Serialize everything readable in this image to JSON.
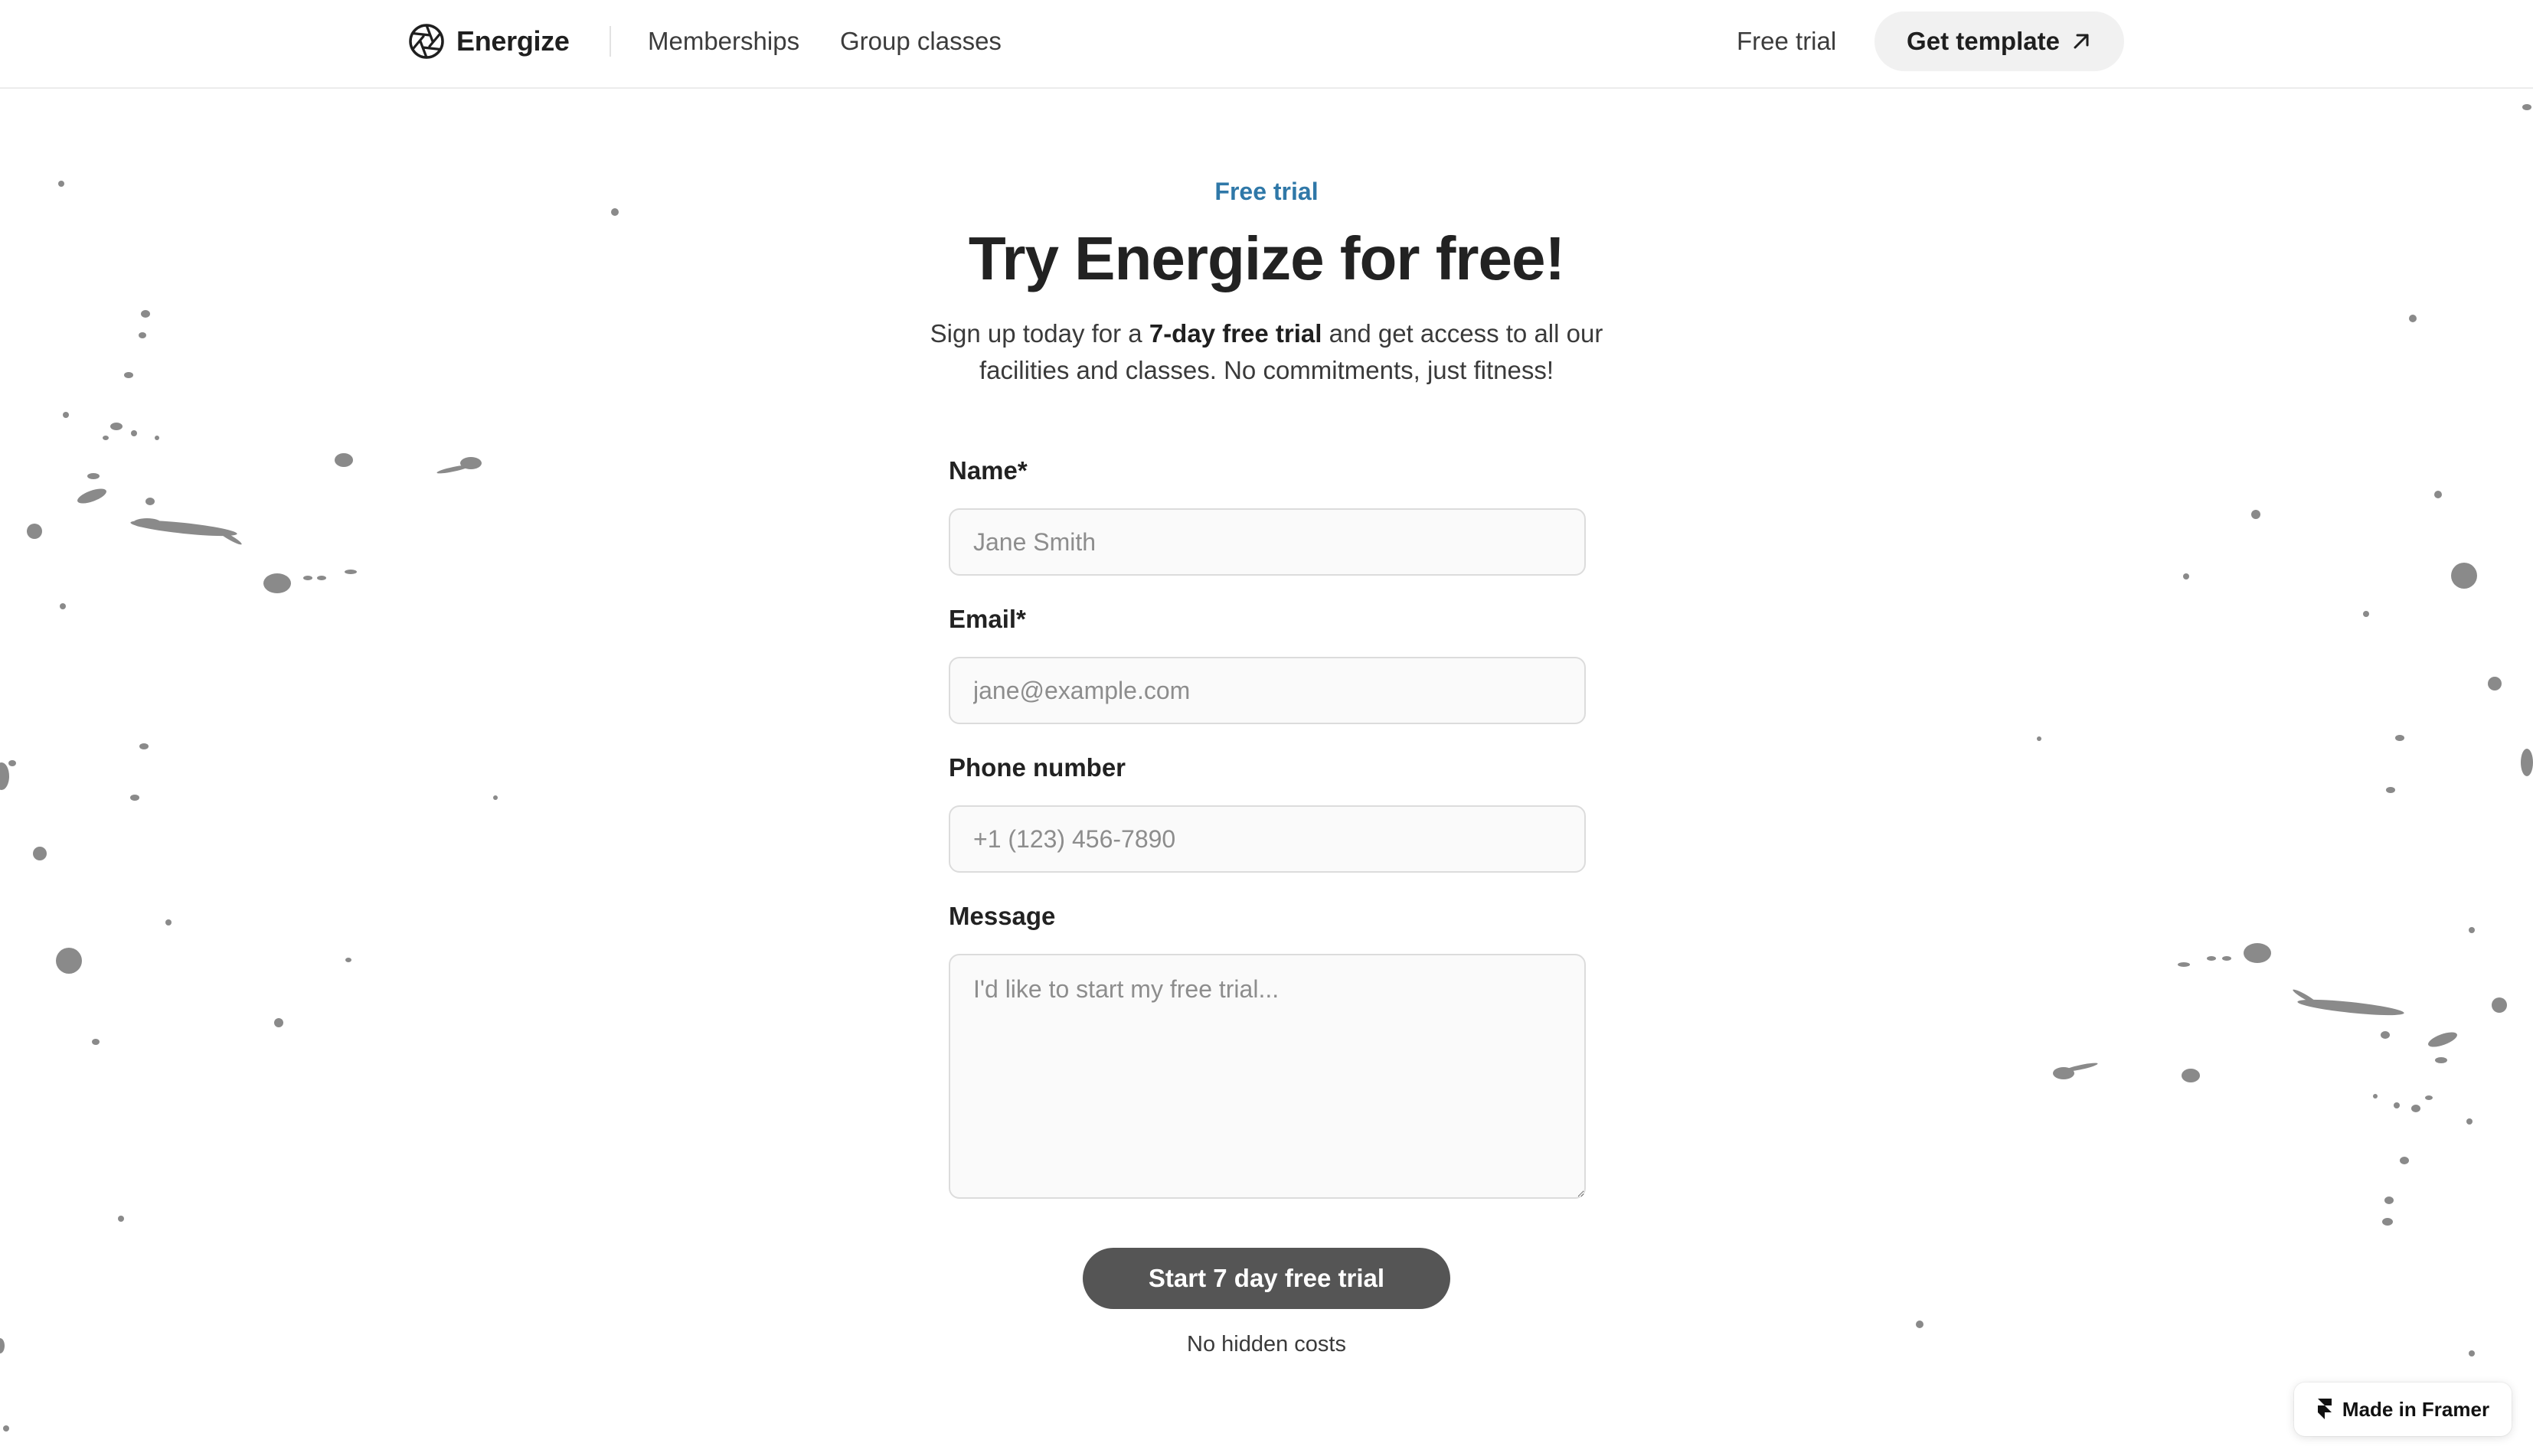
{
  "header": {
    "brand": "Energize",
    "nav": [
      {
        "label": "Memberships"
      },
      {
        "label": "Group classes"
      }
    ],
    "free_trial_link": "Free trial",
    "get_template_label": "Get template"
  },
  "hero": {
    "eyebrow": "Free trial",
    "title": "Try Energize for free!",
    "subtitle_before": "Sign up today for a ",
    "subtitle_bold": "7-day free trial",
    "subtitle_after": " and get access to all our facilities and classes. No commitments, just fitness!"
  },
  "form": {
    "name": {
      "label": "Name*",
      "placeholder": "Jane Smith",
      "value": ""
    },
    "email": {
      "label": "Email*",
      "placeholder": "jane@example.com",
      "value": ""
    },
    "phone": {
      "label": "Phone number",
      "placeholder": "+1 (123) 456-7890",
      "value": ""
    },
    "message": {
      "label": "Message",
      "placeholder": "I'd like to start my free trial...",
      "value": ""
    },
    "submit_label": "Start 7 day free trial",
    "footnote": "No hidden costs"
  },
  "badge": {
    "label": "Made in Framer",
    "icon": "framer-icon"
  },
  "icons": {
    "logo": "aperture-logo-icon",
    "get_template": "arrow-up-right-icon"
  },
  "colors": {
    "accent": "#2f78a8",
    "button_bg": "#555555",
    "button_text": "#ffffff",
    "pill_bg": "#f1f1f1",
    "splatter": "#8a8a8a"
  }
}
